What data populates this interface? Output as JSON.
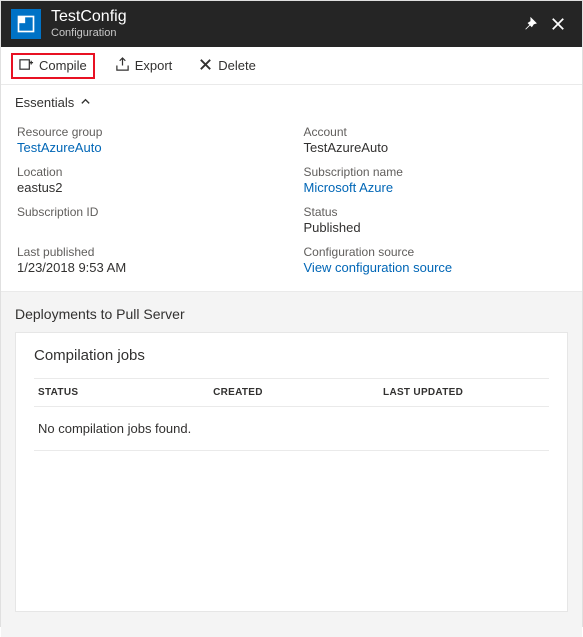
{
  "header": {
    "title": "TestConfig",
    "subtitle": "Configuration"
  },
  "toolbar": {
    "compile": "Compile",
    "export": "Export",
    "delete": "Delete"
  },
  "essentials": {
    "toggle_label": "Essentials",
    "left": {
      "resource_group_label": "Resource group",
      "resource_group_value": "TestAzureAuto",
      "location_label": "Location",
      "location_value": "eastus2",
      "subscription_id_label": "Subscription ID",
      "subscription_id_value": "",
      "last_published_label": "Last published",
      "last_published_value": "1/23/2018 9:53 AM"
    },
    "right": {
      "account_label": "Account",
      "account_value": "TestAzureAuto",
      "subscription_name_label": "Subscription name",
      "subscription_name_value": "Microsoft Azure",
      "status_label": "Status",
      "status_value": "Published",
      "config_source_label": "Configuration source",
      "config_source_value": "View configuration source"
    }
  },
  "deployments": {
    "section_title": "Deployments to Pull Server",
    "card_title": "Compilation jobs",
    "columns": {
      "status": "STATUS",
      "created": "CREATED",
      "updated": "LAST UPDATED"
    },
    "empty_message": "No compilation jobs found."
  }
}
